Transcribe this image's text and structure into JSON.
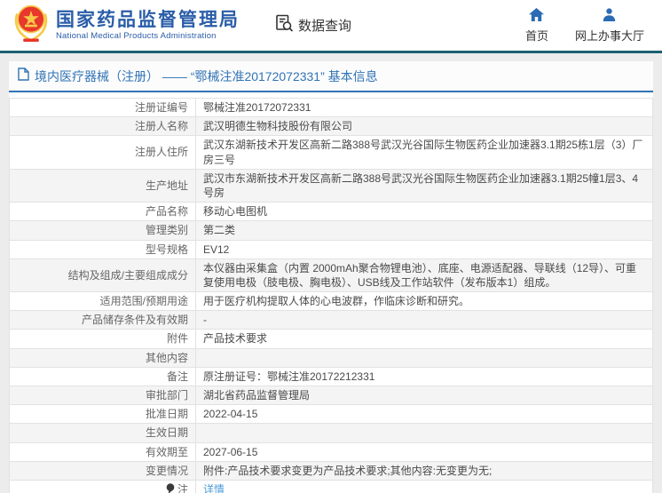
{
  "colors": {
    "brand_blue": "#2a5da8",
    "divider_teal": "#1e6072",
    "title_blue": "#3173b5",
    "link_blue": "#4a9bd5",
    "emblem_red": "#e8372c",
    "emblem_gold": "#f7c948"
  },
  "header": {
    "agency_cn": "国家药品监督管理局",
    "agency_en": "National Medical Products Administration",
    "data_query_label": "数据查询",
    "data_query_icon": "document-search-icon",
    "nav": [
      {
        "label": "首页",
        "icon": "home-icon"
      },
      {
        "label": "网上办事大厅",
        "icon": "person-icon"
      }
    ]
  },
  "title_bar": {
    "icon": "document-icon",
    "text": "境内医疗器械（注册） —— “鄂械注准20172072331” 基本信息"
  },
  "table": {
    "rows": [
      {
        "label": "注册证编号",
        "value": "鄂械注准20172072331"
      },
      {
        "label": "注册人名称",
        "value": "武汉明德生物科技股份有限公司"
      },
      {
        "label": "注册人住所",
        "value": "武汉东湖新技术开发区高新二路388号武汉光谷国际生物医药企业加速器3.1期25栋1层（3）厂房三号"
      },
      {
        "label": "生产地址",
        "value": "武汉市东湖新技术开发区高新二路388号武汉光谷国际生物医药企业加速器3.1期25幢1层3、4号房"
      },
      {
        "label": "产品名称",
        "value": "移动心电图机"
      },
      {
        "label": "管理类别",
        "value": "第二类"
      },
      {
        "label": "型号规格",
        "value": "EV12"
      },
      {
        "label": "结构及组成/主要组成成分",
        "value": "本仪器由采集盒（内置 2000mAh聚合物锂电池）、底座、电源适配器、导联线（12导）、可重复使用电极（肢电极、胸电极）、USB线及工作站软件（发布版本1）组成。"
      },
      {
        "label": "适用范围/预期用途",
        "value": "用于医疗机构提取人体的心电波群，作临床诊断和研究。"
      },
      {
        "label": "产品储存条件及有效期",
        "value": "-"
      },
      {
        "label": "附件",
        "value": "产品技术要求"
      },
      {
        "label": "其他内容",
        "value": ""
      },
      {
        "label": "备注",
        "value": "原注册证号：鄂械注准20172212331"
      },
      {
        "label": "审批部门",
        "value": "湖北省药品监督管理局"
      },
      {
        "label": "批准日期",
        "value": "2022-04-15"
      },
      {
        "label": "生效日期",
        "value": ""
      },
      {
        "label": "有效期至",
        "value": "2027-06-15"
      },
      {
        "label": "变更情况",
        "value": "附件:产品技术要求变更为产品技术要求;其他内容:无变更为无;"
      },
      {
        "label": "注",
        "value": "详情",
        "note_icon": true,
        "link": true
      }
    ]
  }
}
